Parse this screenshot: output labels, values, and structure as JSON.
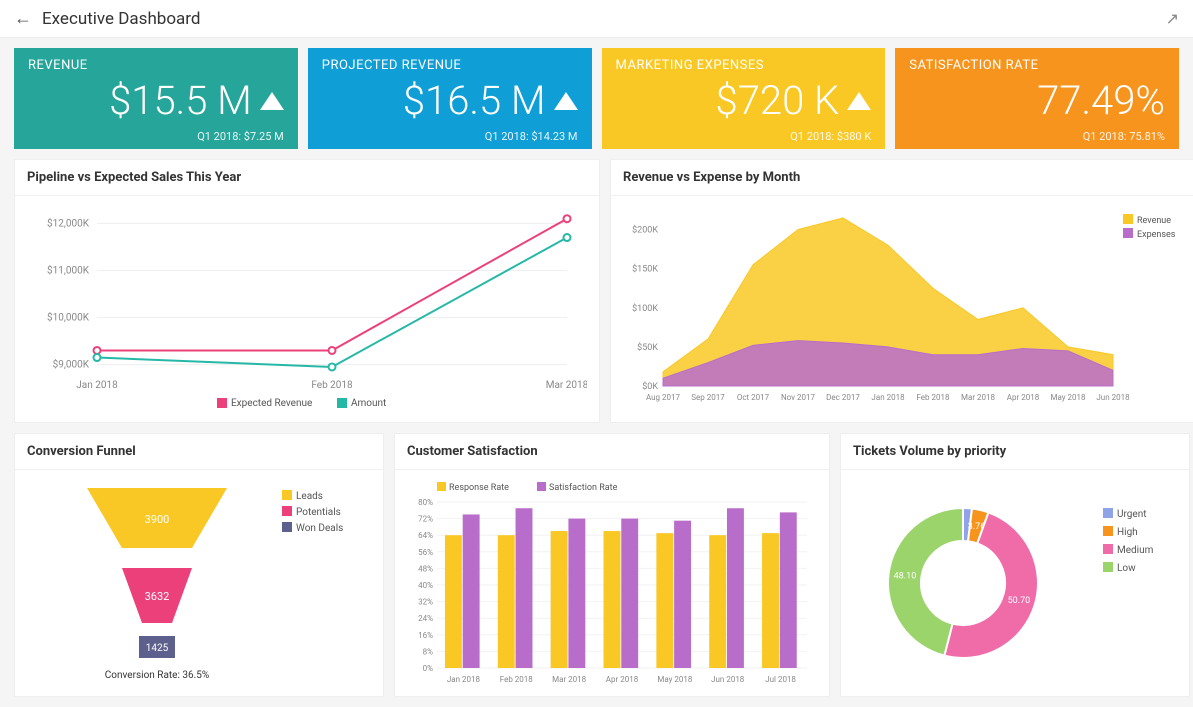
{
  "header": {
    "title": "Executive Dashboard"
  },
  "colors": {
    "teal": "#26A69A",
    "blue": "#0F9ED5",
    "yellow": "#F9C825",
    "orange": "#F7941D",
    "pink": "#EC407A",
    "purple": "#B96DCB",
    "green": "#9BD46A",
    "slate": "#5D5F8D"
  },
  "kpi": [
    {
      "label": "REVENUE",
      "value": "$15.5 M",
      "trend": "up",
      "sub": "Q1 2018: $7.25 M",
      "color": "#26A69A"
    },
    {
      "label": "PROJECTED REVENUE",
      "value": "$16.5 M",
      "trend": "up",
      "sub": "Q1 2018: $14.23 M",
      "color": "#0F9ED5"
    },
    {
      "label": "MARKETING EXPENSES",
      "value": "$720 K",
      "trend": "up",
      "sub": "Q1 2018: $380 K",
      "color": "#F9C825"
    },
    {
      "label": "SATISFACTION RATE",
      "value": "77.49%",
      "trend": "",
      "sub": "Q1 2018: 75.81%",
      "color": "#F7941D"
    }
  ],
  "chart_data": [
    {
      "id": "pipeline",
      "type": "line",
      "title": "Pipeline vs Expected Sales This Year",
      "categories": [
        "Jan 2018",
        "Feb 2018",
        "Mar 2018"
      ],
      "y_ticks": [
        "$9,000K",
        "$10,000K",
        "$11,000K",
        "$12,000K"
      ],
      "ylim": [
        8800,
        12200
      ],
      "series": [
        {
          "name": "Expected Revenue",
          "color": "#EC407A",
          "values": [
            9300,
            9300,
            12100
          ]
        },
        {
          "name": "Amount",
          "color": "#26B8A7",
          "values": [
            9150,
            8950,
            11700
          ]
        }
      ]
    },
    {
      "id": "rev_exp",
      "type": "area",
      "title": "Revenue vs Expense by Month",
      "categories": [
        "Aug 2017",
        "Sep 2017",
        "Oct 2017",
        "Nov 2017",
        "Dec 2017",
        "Jan 2018",
        "Feb 2018",
        "Mar 2018",
        "Apr 2018",
        "May 2018",
        "Jun 2018"
      ],
      "y_ticks": [
        "$0K",
        "$50K",
        "$100K",
        "$150K",
        "$200K"
      ],
      "ylim": [
        0,
        220
      ],
      "series": [
        {
          "name": "Revenue",
          "color": "#F9C825",
          "values": [
            18,
            60,
            155,
            200,
            215,
            180,
            125,
            85,
            100,
            50,
            40
          ]
        },
        {
          "name": "Expenses",
          "color": "#B96DCB",
          "values": [
            10,
            30,
            52,
            58,
            55,
            50,
            40,
            40,
            48,
            45,
            20
          ]
        }
      ]
    },
    {
      "id": "funnel",
      "type": "funnel",
      "title": "Conversion Funnel",
      "legend": [
        "Leads",
        "Potentials",
        "Won Deals"
      ],
      "stages": [
        {
          "name": "Leads",
          "value": 3900,
          "color": "#F9C825"
        },
        {
          "name": "Potentials",
          "value": 3632,
          "color": "#EC407A"
        },
        {
          "name": "Won Deals",
          "value": 1425,
          "color": "#5D5F8D"
        }
      ],
      "footer": "Conversion Rate: 36.5%"
    },
    {
      "id": "csat",
      "type": "bar",
      "title": "Customer Satisfaction",
      "categories": [
        "Jan 2018",
        "Feb 2018",
        "Mar 2018",
        "Apr 2018",
        "May 2018",
        "Jun 2018",
        "Jul 2018"
      ],
      "y_ticks": [
        "0%",
        "8%",
        "16%",
        "24%",
        "32%",
        "40%",
        "48%",
        "56%",
        "64%",
        "72%",
        "80%"
      ],
      "ylim": [
        0,
        80
      ],
      "series": [
        {
          "name": "Response Rate",
          "color": "#F9C825",
          "values": [
            64,
            64,
            66,
            66,
            65,
            64,
            65
          ]
        },
        {
          "name": "Satisfaction Rate",
          "color": "#B96DCB",
          "values": [
            74,
            77,
            72,
            72,
            71,
            77,
            75
          ]
        }
      ]
    },
    {
      "id": "tickets",
      "type": "pie",
      "title": "Tickets Volume by priority",
      "slices": [
        {
          "name": "Urgent",
          "value": 2.0,
          "color": "#8FA4E8",
          "label": ""
        },
        {
          "name": "High",
          "value": 3.76,
          "color": "#F7941D",
          "label": "3.76"
        },
        {
          "name": "Medium",
          "value": 50.7,
          "color": "#F06CA9",
          "label": "50.70"
        },
        {
          "name": "Low",
          "value": 48.1,
          "color": "#9BD46A",
          "label": "48.10"
        }
      ]
    }
  ]
}
